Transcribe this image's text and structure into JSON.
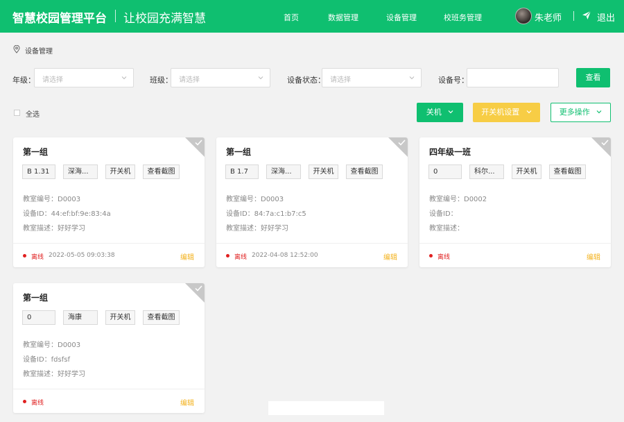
{
  "header": {
    "brand": "智慧校园管理平台",
    "slogan": "让校园充满智慧",
    "nav": [
      "首页",
      "数据管理",
      "设备管理",
      "校班务管理"
    ],
    "username": "朱老师",
    "logout": "退出",
    "brand_color": "#0fbf70"
  },
  "breadcrumb": "设备管理",
  "filters": {
    "grade_label": "年级：",
    "grade_placeholder": "请选择",
    "class_label": "班级：",
    "class_placeholder": "请选择",
    "status_label": "设备状态：",
    "status_placeholder": "请选择",
    "device_label": "设备号：",
    "device_value": "",
    "query_button": "查看"
  },
  "actions": {
    "select_all": "全选",
    "shutdown": "关机",
    "power_settings": "开关机设置",
    "more": "更多操作",
    "accent_yellow": "#f7cd45"
  },
  "cards": [
    {
      "title": "第一组",
      "chip1": "B 1.31",
      "chip2": "深海...",
      "power": "开关机",
      "screenshot": "查看截图",
      "room": "教室编号：D0003",
      "device": "设备ID：44:ef:bf:9e:83:4a",
      "desc": "教室描述：好好学习",
      "status": "离线",
      "time": "2022-05-05 09:03:38",
      "edit": "编辑"
    },
    {
      "title": "第一组",
      "chip1": "B 1.7",
      "chip2": "深海...",
      "power": "开关机",
      "screenshot": "查看截图",
      "room": "教室编号：D0003",
      "device": "设备ID：84:7a:c1:b7:c5",
      "desc": "教室描述：好好学习",
      "status": "离线",
      "time": "2022-04-08 12:52:00",
      "edit": "编辑"
    },
    {
      "title": "四年级一班",
      "chip1": "0",
      "chip2": "科尔...",
      "power": "开关机",
      "screenshot": "查看截图",
      "room": "教室编号：D0002",
      "device": "设备ID：",
      "desc": "教室描述：",
      "status": "离线",
      "time": "",
      "edit": "编辑"
    },
    {
      "title": "第一组",
      "chip1": "0",
      "chip2": "海康",
      "power": "开关机",
      "screenshot": "查看截图",
      "room": "教室编号：D0003",
      "device": "设备ID：fdsfsf",
      "desc": "教室描述：好好学习",
      "status": "离线",
      "time": "",
      "edit": "编辑"
    }
  ]
}
